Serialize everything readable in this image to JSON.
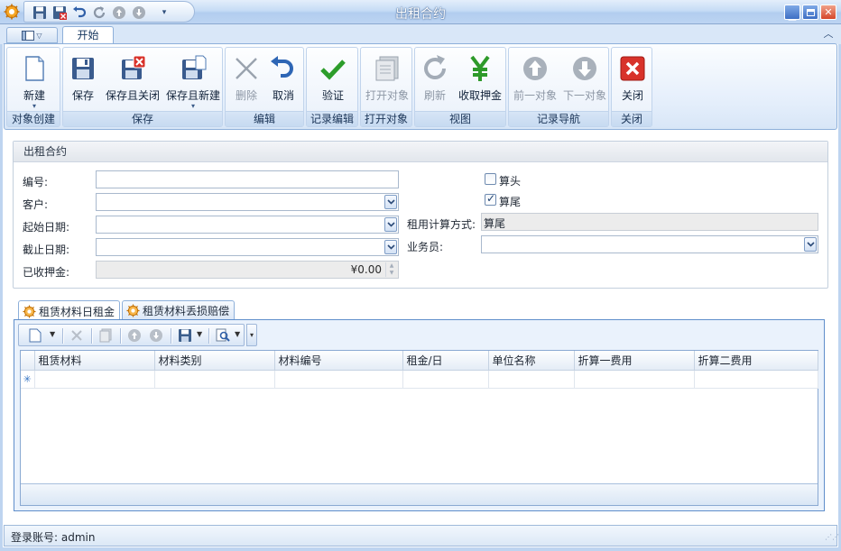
{
  "window": {
    "title": "出租合约"
  },
  "ribbon": {
    "tab_active": "开始",
    "groups": [
      {
        "caption": "对象创建",
        "buttons": [
          {
            "label": "新建",
            "icon": "new-document-icon"
          }
        ]
      },
      {
        "caption": "保存",
        "buttons": [
          {
            "label": "保存",
            "icon": "save-icon"
          },
          {
            "label": "保存且关闭",
            "icon": "save-close-icon"
          },
          {
            "label": "保存且新建",
            "icon": "save-new-icon"
          }
        ]
      },
      {
        "caption": "编辑",
        "buttons": [
          {
            "label": "删除",
            "icon": "delete-icon"
          },
          {
            "label": "取消",
            "icon": "undo-icon"
          }
        ]
      },
      {
        "caption": "记录编辑",
        "buttons": [
          {
            "label": "验证",
            "icon": "checkmark-icon"
          }
        ]
      },
      {
        "caption": "打开对象",
        "buttons": [
          {
            "label": "打开对象",
            "icon": "open-object-icon"
          }
        ]
      },
      {
        "caption": "视图",
        "buttons": [
          {
            "label": "刷新",
            "icon": "refresh-icon"
          },
          {
            "label": "收取押金",
            "icon": "yen-icon"
          }
        ]
      },
      {
        "caption": "记录导航",
        "buttons": [
          {
            "label": "前一对象",
            "icon": "arrow-up-icon"
          },
          {
            "label": "下一对象",
            "icon": "arrow-down-icon"
          }
        ]
      },
      {
        "caption": "关闭",
        "buttons": [
          {
            "label": "关闭",
            "icon": "close-red-icon"
          }
        ]
      }
    ]
  },
  "form": {
    "title": "出租合约",
    "labels": {
      "number": "编号:",
      "customer": "客户:",
      "start_date": "起始日期:",
      "end_date": "截止日期:",
      "deposit": "已收押金:",
      "count_start": "算头",
      "count_end": "算尾",
      "rent_method": "租用计算方式:",
      "salesperson": "业务员:"
    },
    "values": {
      "number": "",
      "customer": "",
      "start_date": "",
      "end_date": "",
      "deposit": "¥0.00",
      "count_start": false,
      "count_end": true,
      "rent_method": "算尾",
      "salesperson": ""
    }
  },
  "detail_tabs": [
    {
      "label": "租赁材料日租金",
      "active": true
    },
    {
      "label": "租赁材料丢损赔偿",
      "active": false
    }
  ],
  "grid": {
    "columns": [
      "租赁材料",
      "材料类别",
      "材料编号",
      "租金/日",
      "单位名称",
      "折算一费用",
      "折算二费用"
    ],
    "new_row_marker": "✳"
  },
  "status": {
    "login": "登录账号: admin"
  }
}
